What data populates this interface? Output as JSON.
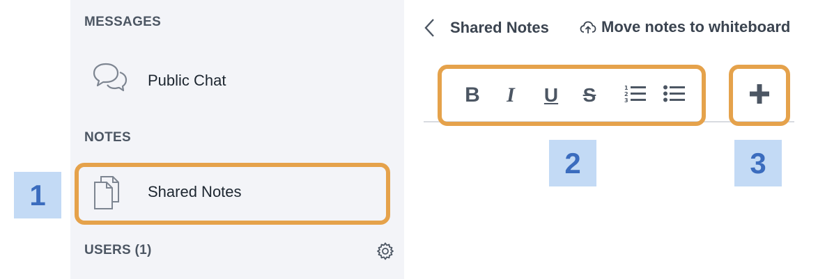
{
  "sidebar": {
    "messages_title": "MESSAGES",
    "public_chat_label": "Public Chat",
    "notes_title": "NOTES",
    "shared_notes_label": "Shared Notes",
    "users_title": "USERS (1)"
  },
  "panel": {
    "title": "Shared Notes",
    "move_label": "Move notes to whiteboard"
  },
  "toolbar": {
    "bold": "B",
    "italic": "I",
    "underline": "U",
    "strike": "S"
  },
  "badges": {
    "one": "1",
    "two": "2",
    "three": "3"
  },
  "colors": {
    "highlight": "#e5a24b",
    "badge_bg": "#c3daf5",
    "badge_text": "#3b6cbe",
    "sidebar_bg": "#f3f4f8"
  },
  "icons": [
    "chat-bubbles-icon",
    "documents-icon",
    "gear-icon",
    "chevron-left-icon",
    "cloud-upload-icon",
    "ordered-list-icon",
    "bullet-list-icon",
    "plus-icon"
  ]
}
